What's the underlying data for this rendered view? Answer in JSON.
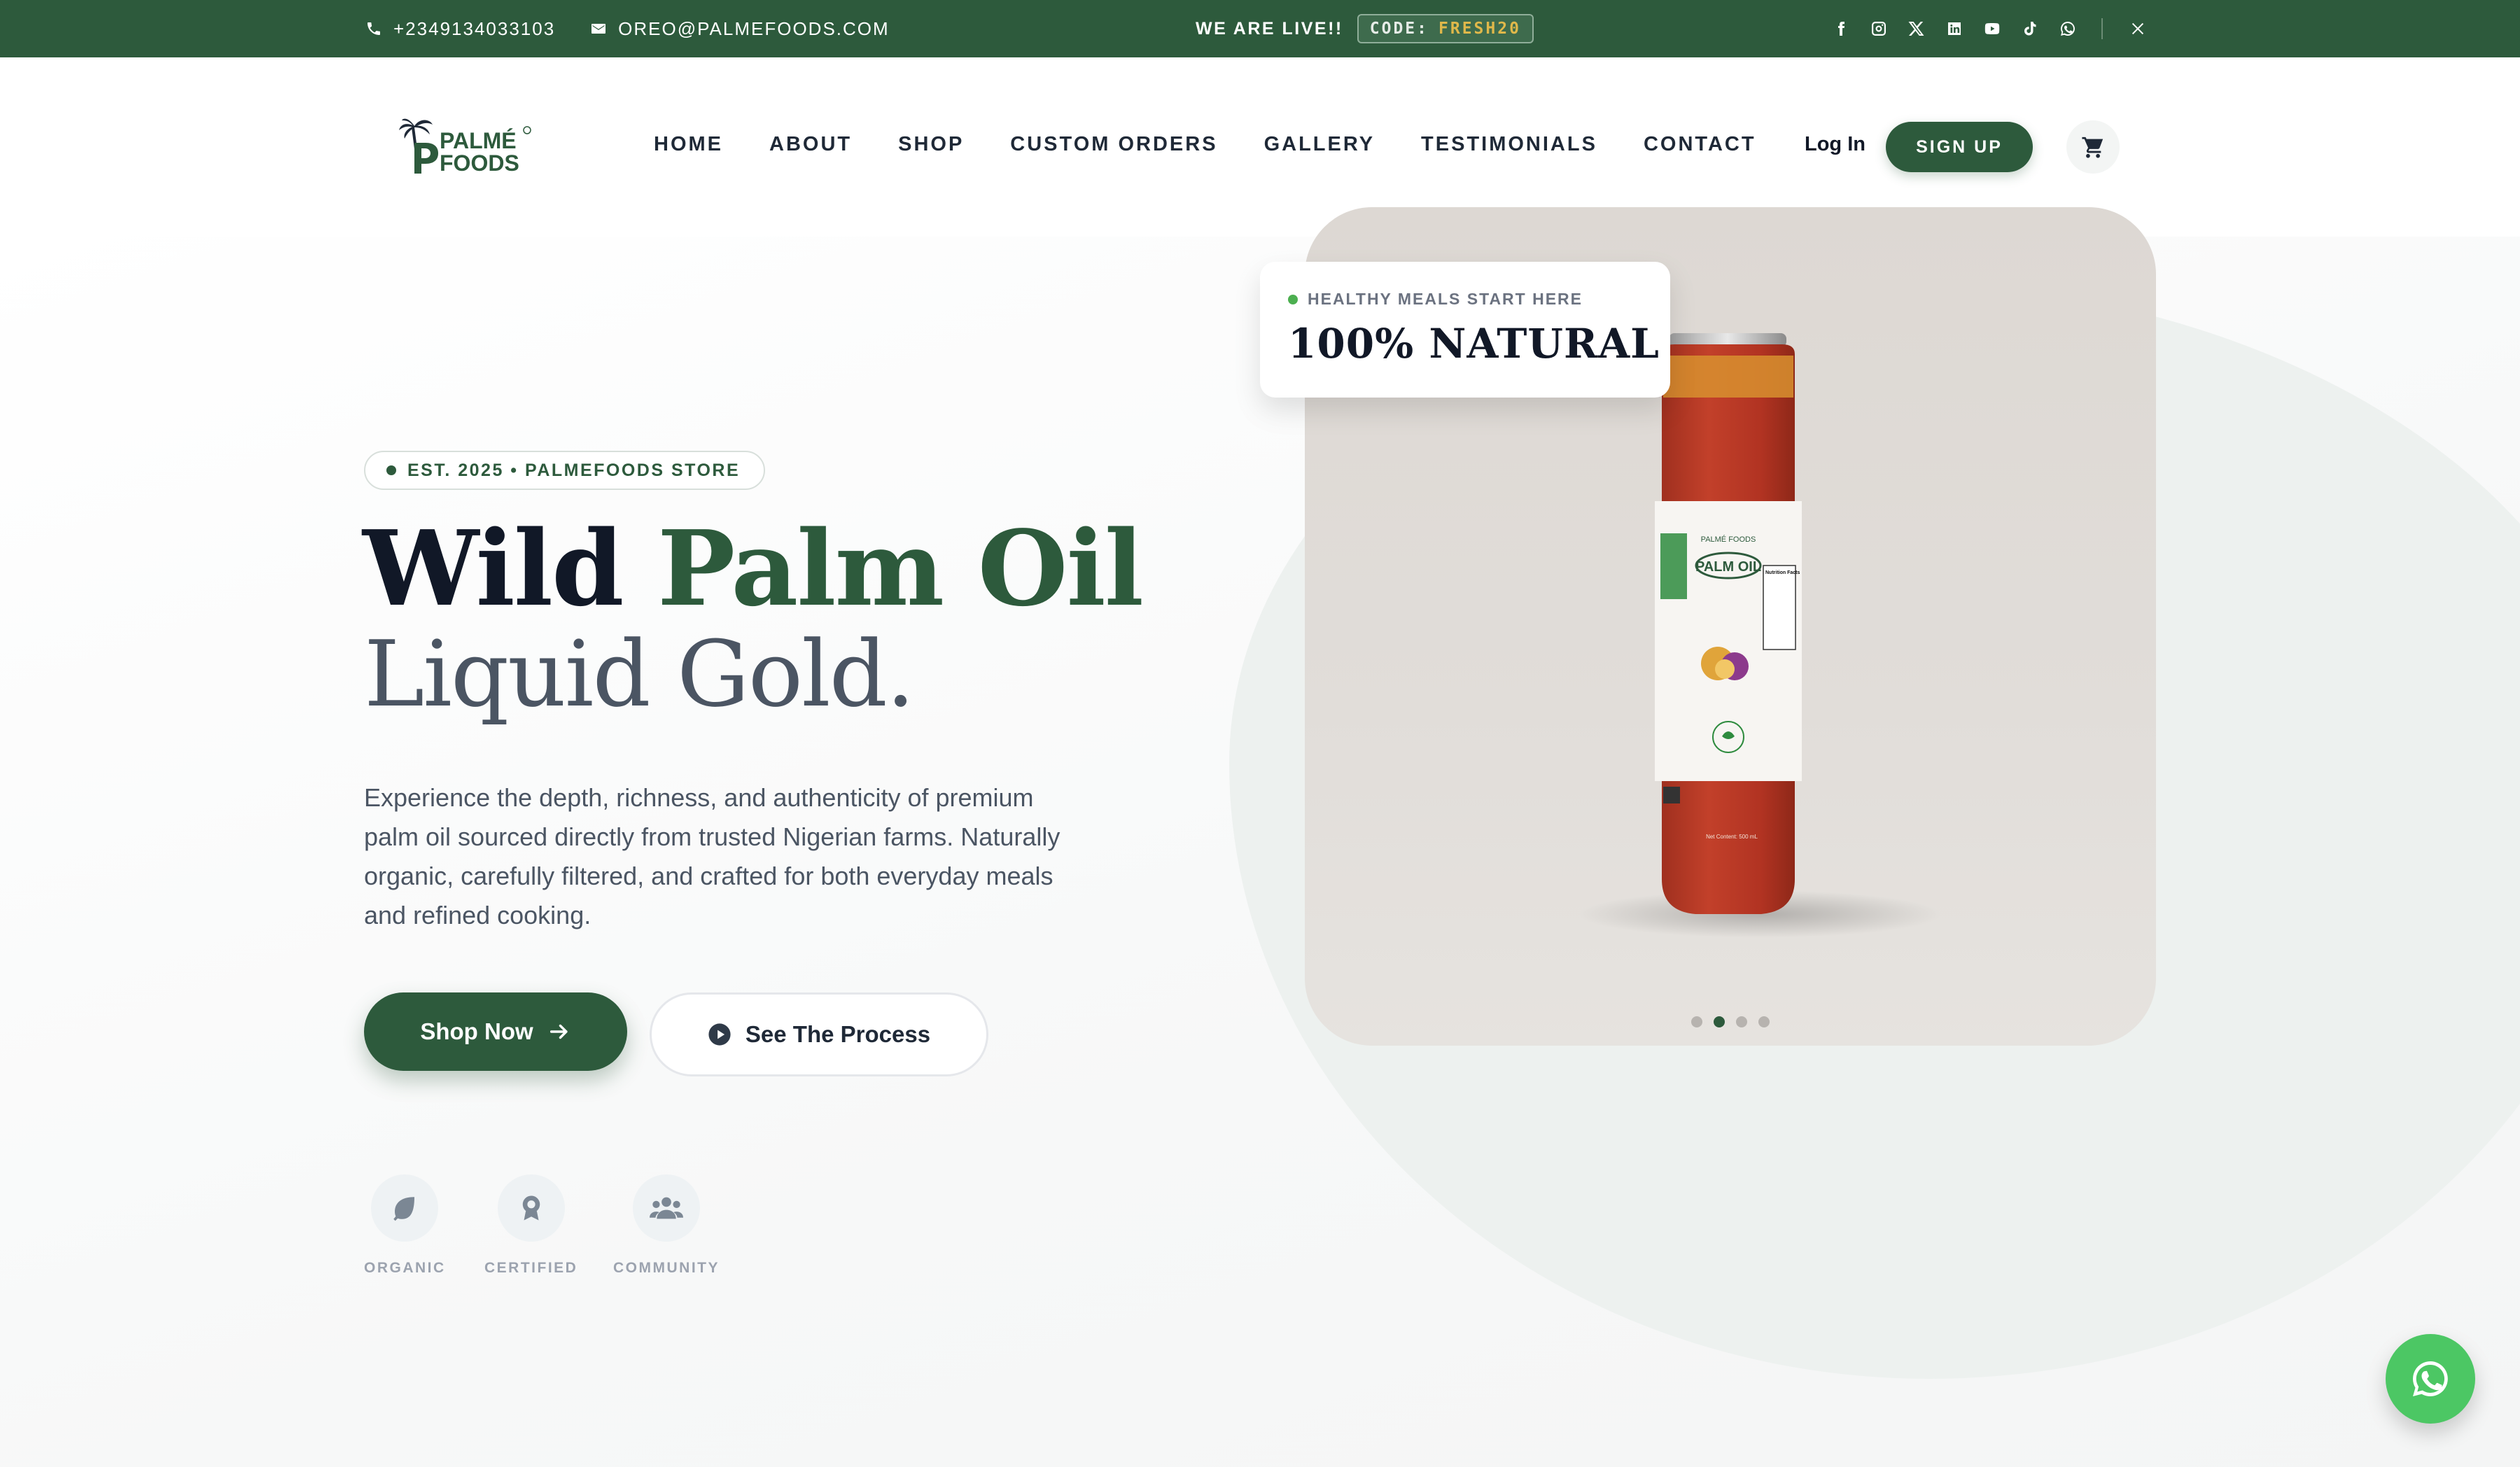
{
  "topbar": {
    "phone": "+2349134033103",
    "email": "OREO@PALMEFOODS.COM",
    "live_text": "WE ARE LIVE!!",
    "code_label": "CODE:",
    "code_value": "FRESH20",
    "social_icons": [
      "facebook-icon",
      "instagram-icon",
      "x-icon",
      "linkedin-icon",
      "youtube-icon",
      "tiktok-icon",
      "whatsapp-icon"
    ],
    "bg_color": "#2d5a3c",
    "code_color": "#e0b84a"
  },
  "header": {
    "logo_line1": "PALMÉ",
    "logo_line2": "FOODS",
    "nav": [
      "HOME",
      "ABOUT",
      "SHOP",
      "CUSTOM ORDERS",
      "GALLERY",
      "TESTIMONIALS",
      "CONTACT"
    ],
    "login_label": "Log In",
    "signup_label": "SIGN UP"
  },
  "hero": {
    "badge": "EST. 2025 • PALMEFOODS STORE",
    "title_part1": "Wild",
    "title_part2": "Palm Oil",
    "subtitle": "Liquid Gold.",
    "description": "Experience the depth, richness, and authenticity of premium palm oil sourced directly from trusted Nigerian farms. Naturally organic, carefully filtered, and crafted for both everyday meals and refined cooking.",
    "primary_button": "Shop Now",
    "secondary_button": "See The Process",
    "features": [
      "ORGANIC",
      "CERTIFIED",
      "COMMUNITY"
    ],
    "card_tag_small": "HEALTHY MEALS START HERE",
    "card_tag_big": "100% NATURAL",
    "product_label_brand": "PALMÉ FOODS",
    "product_label_name": "PALM OIL",
    "product_label_nutrition": "Nutrition Facts",
    "product_label_net": "Net Content: 500 mL",
    "carousel_total": 4,
    "carousel_active": 2,
    "accent_color": "#2d5a3c"
  }
}
